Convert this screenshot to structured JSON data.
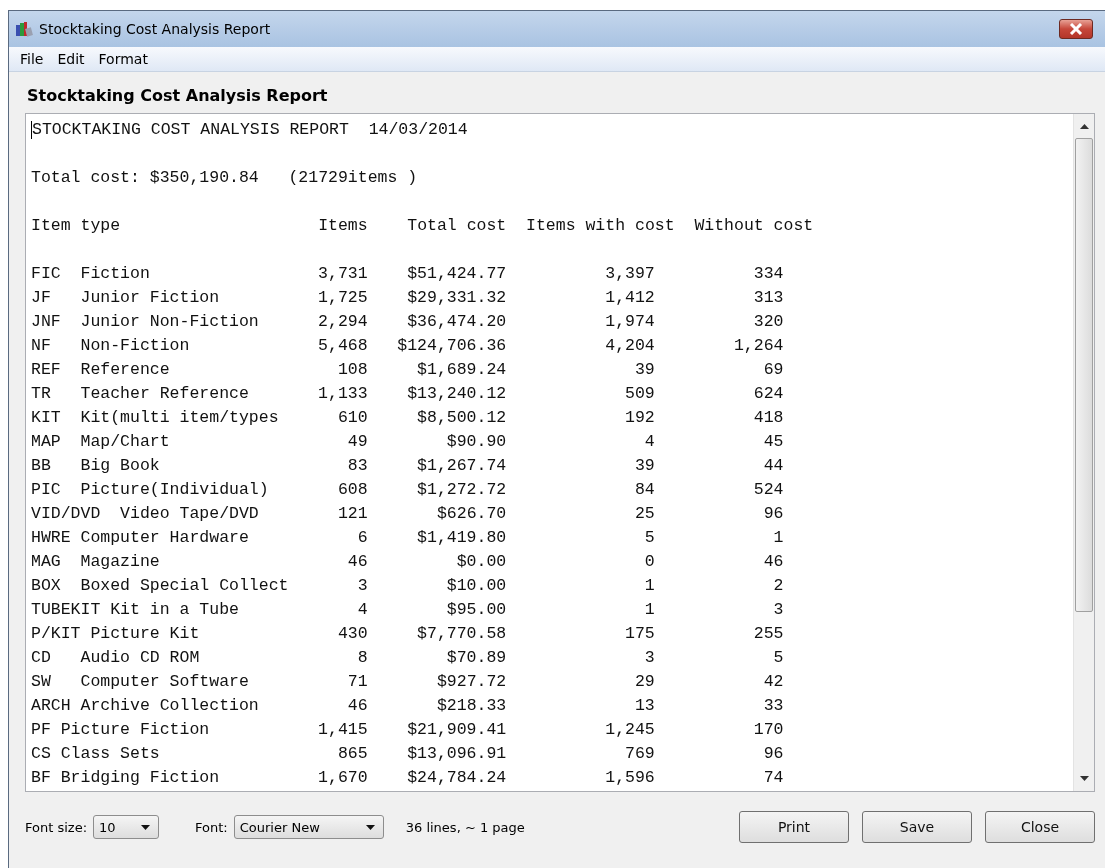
{
  "window": {
    "title": "Stocktaking Cost Analysis Report"
  },
  "menu": [
    "File",
    "Edit",
    "Format"
  ],
  "heading": "Stocktaking Cost Analysis Report",
  "report": {
    "title_line": "STOCKTAKING COST ANALYSIS REPORT  14/03/2014",
    "total_line": "Total cost: $350,190.84   (21729items )",
    "columns": [
      "Item type",
      "Items",
      "Total cost",
      "Items with cost",
      "Without cost"
    ],
    "rows": [
      {
        "item_type": "FIC  Fiction",
        "items": "3,731",
        "total_cost": "$51,424.77",
        "with_cost": "3,397",
        "without_cost": "334"
      },
      {
        "item_type": "JF   Junior Fiction",
        "items": "1,725",
        "total_cost": "$29,331.32",
        "with_cost": "1,412",
        "without_cost": "313"
      },
      {
        "item_type": "JNF  Junior Non-Fiction",
        "items": "2,294",
        "total_cost": "$36,474.20",
        "with_cost": "1,974",
        "without_cost": "320"
      },
      {
        "item_type": "NF   Non-Fiction",
        "items": "5,468",
        "total_cost": "$124,706.36",
        "with_cost": "4,204",
        "without_cost": "1,264"
      },
      {
        "item_type": "REF  Reference",
        "items": "108",
        "total_cost": "$1,689.24",
        "with_cost": "39",
        "without_cost": "69"
      },
      {
        "item_type": "TR   Teacher Reference",
        "items": "1,133",
        "total_cost": "$13,240.12",
        "with_cost": "509",
        "without_cost": "624"
      },
      {
        "item_type": "KIT  Kit(multi item/types",
        "items": "610",
        "total_cost": "$8,500.12",
        "with_cost": "192",
        "without_cost": "418"
      },
      {
        "item_type": "MAP  Map/Chart",
        "items": "49",
        "total_cost": "$90.90",
        "with_cost": "4",
        "without_cost": "45"
      },
      {
        "item_type": "BB   Big Book",
        "items": "83",
        "total_cost": "$1,267.74",
        "with_cost": "39",
        "without_cost": "44"
      },
      {
        "item_type": "PIC  Picture(Individual)",
        "items": "608",
        "total_cost": "$1,272.72",
        "with_cost": "84",
        "without_cost": "524"
      },
      {
        "item_type": "VID/DVD  Video Tape/DVD",
        "items": "121",
        "total_cost": "$626.70",
        "with_cost": "25",
        "without_cost": "96"
      },
      {
        "item_type": "HWRE Computer Hardware",
        "items": "6",
        "total_cost": "$1,419.80",
        "with_cost": "5",
        "without_cost": "1"
      },
      {
        "item_type": "MAG  Magazine",
        "items": "46",
        "total_cost": "$0.00",
        "with_cost": "0",
        "without_cost": "46"
      },
      {
        "item_type": "BOX  Boxed Special Collect",
        "items": "3",
        "total_cost": "$10.00",
        "with_cost": "1",
        "without_cost": "2"
      },
      {
        "item_type": "TUBEKIT Kit in a Tube",
        "items": "4",
        "total_cost": "$95.00",
        "with_cost": "1",
        "without_cost": "3"
      },
      {
        "item_type": "P/KIT Picture Kit",
        "items": "430",
        "total_cost": "$7,770.58",
        "with_cost": "175",
        "without_cost": "255"
      },
      {
        "item_type": "CD   Audio CD ROM",
        "items": "8",
        "total_cost": "$70.89",
        "with_cost": "3",
        "without_cost": "5"
      },
      {
        "item_type": "SW   Computer Software",
        "items": "71",
        "total_cost": "$927.72",
        "with_cost": "29",
        "without_cost": "42"
      },
      {
        "item_type": "ARCH Archive Collection",
        "items": "46",
        "total_cost": "$218.33",
        "with_cost": "13",
        "without_cost": "33"
      },
      {
        "item_type": "PF Picture Fiction",
        "items": "1,415",
        "total_cost": "$21,909.41",
        "with_cost": "1,245",
        "without_cost": "170"
      },
      {
        "item_type": "CS Class Sets",
        "items": "865",
        "total_cost": "$13,096.91",
        "with_cost": "769",
        "without_cost": "96"
      },
      {
        "item_type": "BF Bridging Fiction",
        "items": "1,670",
        "total_cost": "$24,784.24",
        "with_cost": "1,596",
        "without_cost": "74"
      }
    ]
  },
  "footer": {
    "font_size_label": "Font size:",
    "font_size": "10",
    "font_label": "Font:",
    "font": "Courier New",
    "summary": "36 lines, ~ 1 page",
    "buttons": [
      "Print",
      "Save",
      "Close"
    ]
  }
}
